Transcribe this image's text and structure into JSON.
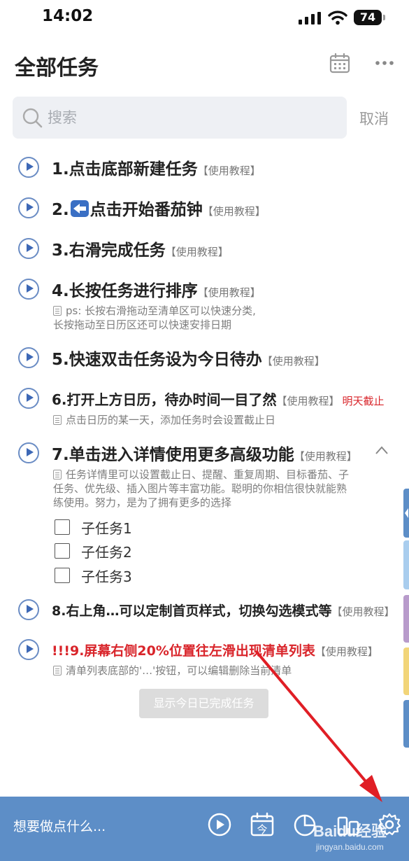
{
  "status_bar": {
    "time": "14:02",
    "battery": "74"
  },
  "header": {
    "title": "全部任务",
    "calendar_icon": "calendar-icon",
    "more_icon": "more-icon"
  },
  "search": {
    "placeholder": "搜索",
    "cancel_label": "取消"
  },
  "tasks": [
    {
      "title": "1.点击底部新建任务",
      "tag": "【使用教程】"
    },
    {
      "title_prefix": "2.",
      "title": "点击开始番茄钟",
      "tag": "【使用教程】",
      "icon": "arrow-left-icon"
    },
    {
      "title": "3.右滑完成任务",
      "tag": "【使用教程】"
    },
    {
      "title": "4.长按任务进行排序",
      "tag": "【使用教程】",
      "note_lines": [
        "ps: 长按右滑拖动至清单区可以快速分类,",
        "长按拖动至日历区还可以快速安排日期"
      ]
    },
    {
      "title": "5.快速双击任务设为今日待办",
      "tag": "【使用教程】"
    },
    {
      "title": "6.打开上方日历，待办时间一目了然",
      "tag": "【使用教程】",
      "due": "明天截止",
      "note_lines": [
        "点击日历的某一天，添加任务时会设置截止日"
      ]
    },
    {
      "title": "7.单击进入详情使用更多高级功能",
      "tag": "【使用教程】",
      "note_lines": [
        "任务详情里可以设置截止日、提醒、重复周期、目标番茄、子",
        "任务、优先级、插入图片等丰富功能。聪明的你相信很快就能熟",
        "练使用。努力，是为了拥有更多的选择"
      ],
      "subtasks": [
        "子任务1",
        "子任务2",
        "子任务3"
      ]
    },
    {
      "title": "8.右上角…可以定制首页样式，切换勾选模式等",
      "tag": "【使用教程】"
    },
    {
      "title": "!!!9.屏幕右侧20%位置往左滑出现清单列表",
      "tag": "【使用教程】",
      "note_lines": [
        "清单列表底部的'…'按钮，可以编辑删除当前清单"
      ]
    }
  ],
  "show_done_label": "显示今日已完成任务",
  "bottom_bar": {
    "prompt": "想要做点什么...",
    "icons": [
      "play-icon",
      "calendar-today-icon",
      "pie-chart-icon",
      "stats-icon",
      "settings-icon"
    ],
    "calendar_glyph": "今"
  },
  "watermark": {
    "brand": "Baidu经验",
    "url": "jingyan.baidu.com"
  },
  "colors": {
    "accent": "#5d8ec7",
    "red": "#d9252b",
    "side_tabs": [
      "#5d8ec7",
      "#a9cdee",
      "#b89bcb",
      "#f2d579",
      "#5d8ec7"
    ]
  }
}
